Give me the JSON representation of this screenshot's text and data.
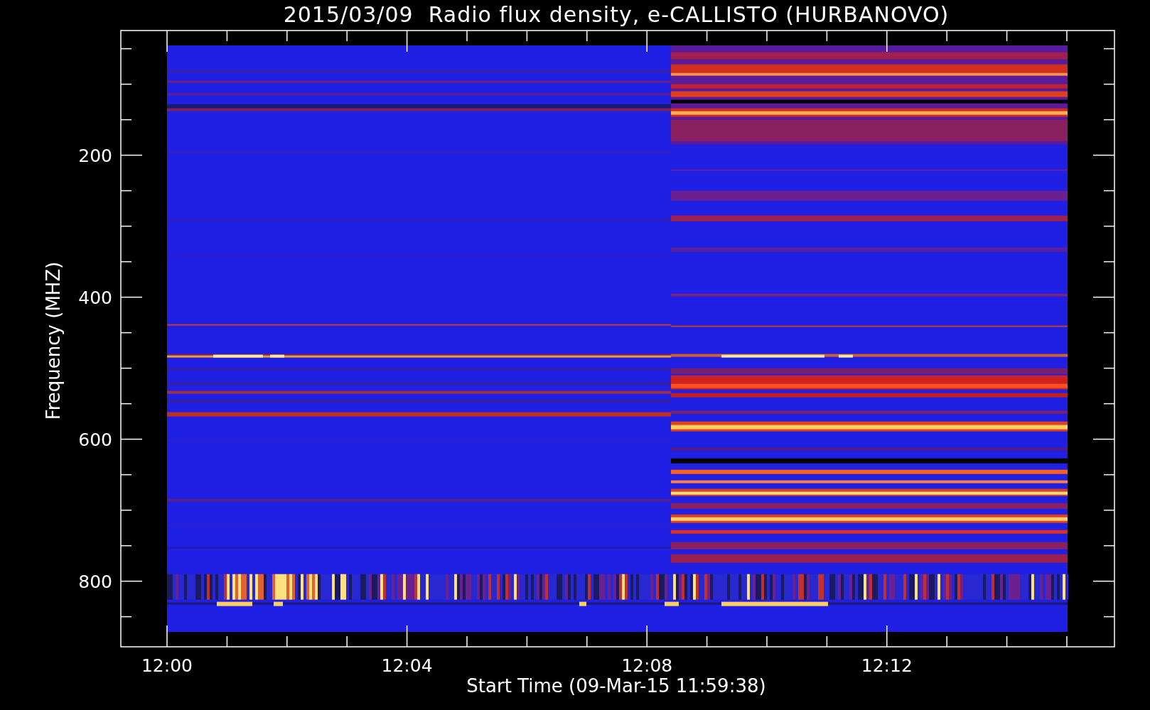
{
  "title": "2015/03/09  Radio flux density, e-CALLISTO (HURBANOVO)",
  "xlabel": "Start Time (09-Mar-15 11:59:38)",
  "ylabel": "Frequency (MHZ)",
  "xtick_labels": [
    "12:00",
    "12:04",
    "12:08",
    "12:12"
  ],
  "ytick_labels": [
    "200",
    "400",
    "600",
    "800"
  ]
}
